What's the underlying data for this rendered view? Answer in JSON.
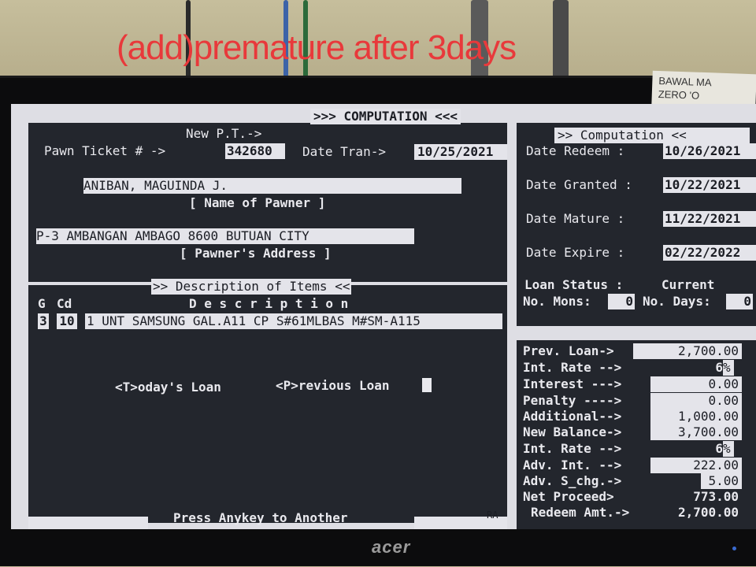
{
  "overlay_caption": "(add)premature after 3days",
  "sticky_note": {
    "line1": "BAWAL MA",
    "line2": "ZERO 'O"
  },
  "monitor_logo": "acer",
  "title_bar": ">>> COMPUTATION <<<",
  "pawn": {
    "new_pt_label": "New P.T.->",
    "ticket_label": "Pawn Ticket # ->",
    "ticket_value": "342680",
    "date_tran_label": "Date Tran->",
    "date_tran_value": "10/25/2021",
    "pawner_name": "ANIBAN, MAGUINDA J.",
    "name_caption": "[ Name of Pawner ]",
    "pawner_address": "P-3 AMBANGAN AMBAGO 8600 BUTUAN CITY",
    "address_caption": "[ Pawner's Address ]"
  },
  "items": {
    "header": ">> Description of Items <<",
    "col_g": "G",
    "col_cd": "Cd",
    "col_desc": "D e s c r i p t i o n",
    "rows": [
      {
        "g": "3",
        "cd": "10",
        "description": "1 UNT SAMSUNG GAL.A11 CP S#61MLBAS M#SM-A115"
      }
    ]
  },
  "loan_prompt": {
    "todays": "<T>oday's Loan",
    "previous": "<P>revious Loan"
  },
  "footer": {
    "press": "Press Anykey to Another",
    "ra": "RA"
  },
  "computation": {
    "header": ">> Computation <<",
    "date_redeem_label": "Date Redeem  :",
    "date_redeem": "10/26/2021",
    "date_granted_label": "Date Granted :",
    "date_granted": "10/22/2021",
    "date_mature_label": "Date Mature  :",
    "date_mature": "11/22/2021",
    "date_expire_label": "Date Expire  :",
    "date_expire": "02/22/2022",
    "loan_status_label": "Loan Status  :",
    "loan_status": "Current",
    "no_mons_label": "No. Mons:",
    "no_mons": "0",
    "no_days_label": "No. Days:",
    "no_days": "0"
  },
  "amounts": {
    "prev_loan_label": "Prev. Loan->",
    "prev_loan": "2,700.00",
    "int_rate_label": "Int. Rate -->",
    "int_rate": "6",
    "interest_label": "Interest --->",
    "interest": "0.00",
    "penalty_label": "Penalty ---->",
    "penalty": "0.00",
    "additional_label": "Additional-->",
    "additional": "1,000.00",
    "new_balance_label": "New Balance->",
    "new_balance": "3,700.00",
    "int_rate2_label": "Int. Rate -->",
    "int_rate2": "6",
    "adv_int_label": "Adv. Int. -->",
    "adv_int": "222.00",
    "adv_schg_label": "Adv. S_chg.->",
    "adv_schg": "5.00",
    "net_proceed_label": "Net Proceed>",
    "net_proceed": "773.00",
    "redeem_amt_label": "Redeem Amt.->",
    "redeem_amt": "2,700.00",
    "percent_sign": "%"
  }
}
